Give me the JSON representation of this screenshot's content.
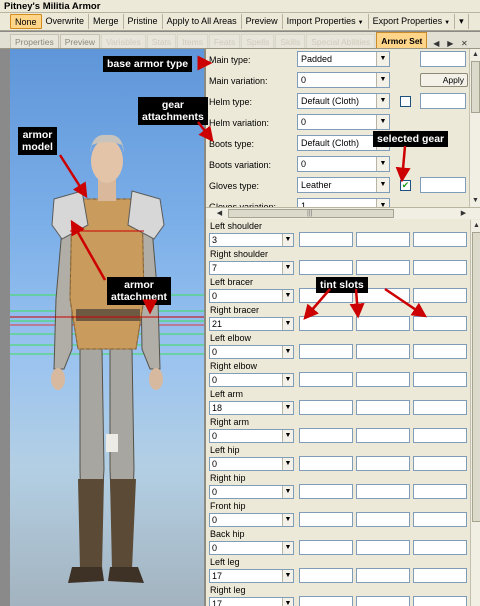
{
  "window": {
    "title": "Pitney's Militia Armor"
  },
  "toolbar": {
    "items": [
      {
        "label": "None",
        "active": true,
        "dropdown": false
      },
      {
        "label": "Overwrite",
        "active": false,
        "dropdown": false
      },
      {
        "label": "Merge",
        "active": false,
        "dropdown": false
      },
      {
        "label": "Pristine",
        "active": false,
        "dropdown": false
      },
      {
        "label": "Apply to All Areas",
        "active": false,
        "dropdown": false
      },
      {
        "label": "Preview",
        "active": false,
        "dropdown": false
      },
      {
        "label": "Import Properties",
        "active": false,
        "dropdown": true
      },
      {
        "label": "Export Properties",
        "active": false,
        "dropdown": true
      }
    ]
  },
  "tabs": [
    {
      "label": "Properties",
      "state": "normal"
    },
    {
      "label": "Preview",
      "state": "normal"
    },
    {
      "label": "Variables",
      "state": "faded"
    },
    {
      "label": "Stats",
      "state": "faded"
    },
    {
      "label": "Items",
      "state": "faded"
    },
    {
      "label": "Feats",
      "state": "faded"
    },
    {
      "label": "Spells",
      "state": "faded"
    },
    {
      "label": "Skills",
      "state": "faded"
    },
    {
      "label": "Special Abilities",
      "state": "faded"
    },
    {
      "label": "Armor Set",
      "state": "active"
    }
  ],
  "properties": [
    {
      "label": "Main type:",
      "value": "Padded",
      "side": "box"
    },
    {
      "label": "Main variation:",
      "value": "0",
      "side": "apply"
    },
    {
      "label": "Helm type:",
      "value": "Default (Cloth)",
      "side": "check",
      "checked": false
    },
    {
      "label": "Helm variation:",
      "value": "0",
      "side": "none"
    },
    {
      "label": "Boots type:",
      "value": "Default (Cloth)",
      "side": "none"
    },
    {
      "label": "Boots variation:",
      "value": "0",
      "side": "none"
    },
    {
      "label": "Gloves type:",
      "value": "Leather",
      "side": "check",
      "checked": true
    },
    {
      "label": "Gloves variation:",
      "value": "1",
      "side": "none"
    }
  ],
  "apply_label": "Apply",
  "attachments": [
    {
      "label": "Left shoulder",
      "value": "3"
    },
    {
      "label": "Right shoulder",
      "value": "7"
    },
    {
      "label": "Left bracer",
      "value": "0"
    },
    {
      "label": "Right bracer",
      "value": "21"
    },
    {
      "label": "Left elbow",
      "value": "0"
    },
    {
      "label": "Right elbow",
      "value": "0"
    },
    {
      "label": "Left arm",
      "value": "18"
    },
    {
      "label": "Right arm",
      "value": "0"
    },
    {
      "label": "Left hip",
      "value": "0"
    },
    {
      "label": "Right hip",
      "value": "0"
    },
    {
      "label": "Front hip",
      "value": "0"
    },
    {
      "label": "Back hip",
      "value": "0"
    },
    {
      "label": "Left leg",
      "value": "17"
    },
    {
      "label": "Right leg",
      "value": "17"
    }
  ],
  "callouts": {
    "base_armor_type": "base armor type",
    "gear_attachments": "gear\nattachments",
    "armor_model": "armor\nmodel",
    "selected_gear": "selected gear",
    "armor_attachment": "armor\nattachment",
    "tint_slots": "tint slots"
  },
  "icons": {
    "dropdown": "chevron-down-icon",
    "check": "checkmark-icon",
    "scroll_up": "arrow-up-icon",
    "scroll_down": "arrow-down-icon",
    "scroll_left": "arrow-left-icon",
    "scroll_right": "arrow-right-icon"
  },
  "colors": {
    "active_highlight": "#ffd58a",
    "callout_bg": "#000000",
    "callout_text": "#ffffff",
    "arrow": "#cc0000",
    "sky": "#7aaee8"
  }
}
